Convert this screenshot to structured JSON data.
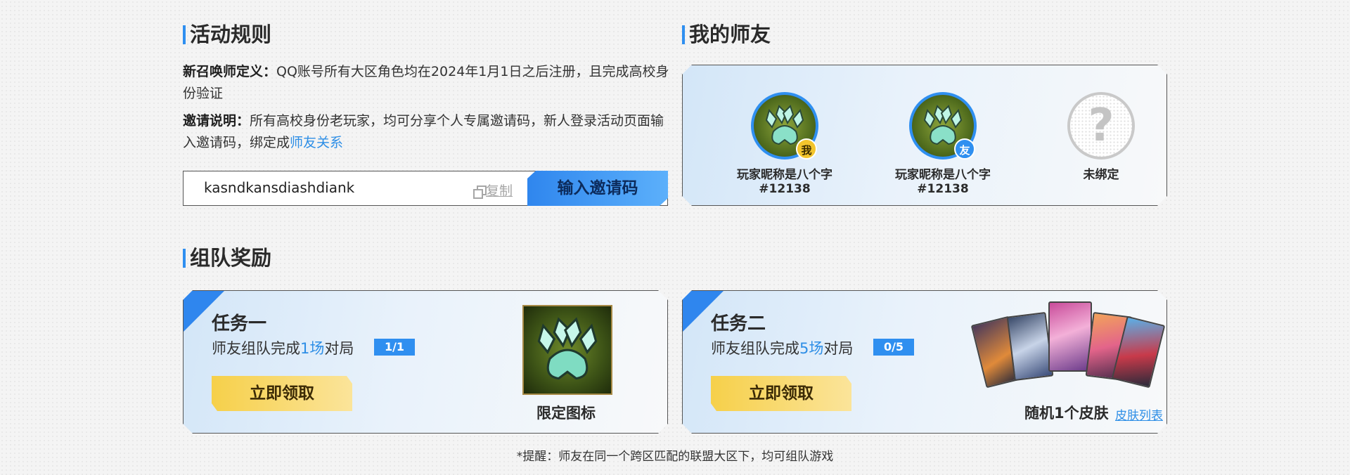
{
  "rules": {
    "title": "活动规则",
    "def_label": "新召唤师定义：",
    "def_text": "QQ账号所有大区角色均在2024年1月1日之后注册，且完成高校身份验证",
    "invite_label": "邀请说明：",
    "invite_text": "所有高校身份老玩家，均可分享个人专属邀请码，新人登录活动页面输入邀请码，绑定成",
    "invite_link": "师友关系",
    "invite_code": "kasndkansdiashdiank",
    "copy_label": "复制",
    "enter_button": "输入邀请码"
  },
  "friends": {
    "title": "我的师友",
    "items": [
      {
        "name": "玩家昵称是八个字#12138",
        "badge": "我",
        "icon": "paw-icon"
      },
      {
        "name": "玩家昵称是八个字#12138",
        "badge": "友",
        "icon": "paw-icon"
      },
      {
        "name": "未绑定",
        "badge": "",
        "icon": "question-icon",
        "empty_symbol": "?"
      }
    ]
  },
  "team": {
    "title": "组队奖励",
    "tasks": [
      {
        "title": "任务一",
        "desc_prefix": "师友组队完成",
        "desc_count": "1场",
        "desc_suffix": "对局",
        "progress": "1/1",
        "claim_button": "立即领取",
        "reward_label": "限定图标",
        "reward_icon": "paw-icon"
      },
      {
        "title": "任务二",
        "desc_prefix": "师友组队完成",
        "desc_count": "5场",
        "desc_suffix": "对局",
        "progress": "0/5",
        "claim_button": "立即领取",
        "reward_label": "随机1个皮肤",
        "reward_link": "皮肤列表"
      }
    ]
  },
  "footer_note": "*提醒：师友在同一个跨区匹配的联盟大区下，均可组队游戏",
  "colors": {
    "accent_blue": "#2f8ff0",
    "link_blue": "#2d8ee6",
    "gold": "#f6d04a"
  }
}
